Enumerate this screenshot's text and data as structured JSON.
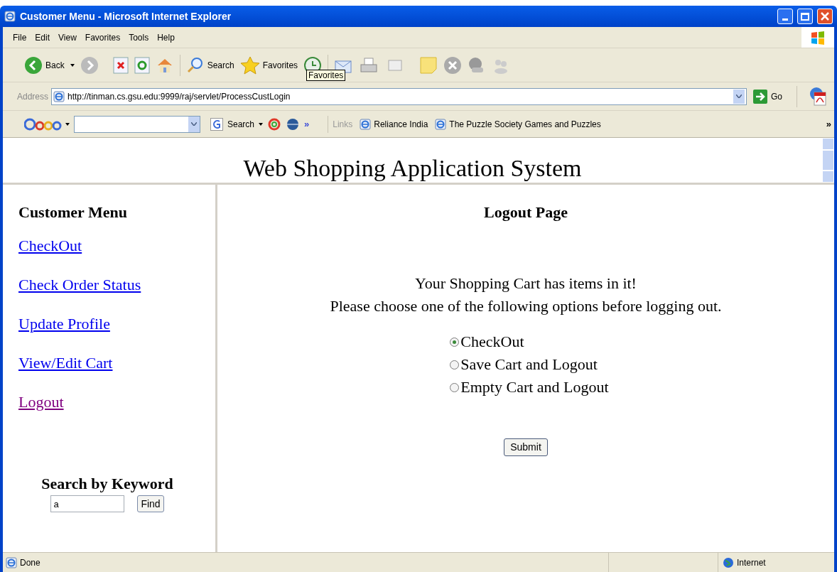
{
  "window": {
    "title": "Customer Menu - Microsoft Internet Explorer"
  },
  "menu": [
    "File",
    "Edit",
    "View",
    "Favorites",
    "Tools",
    "Help"
  ],
  "toolbar": {
    "back": "Back",
    "search": "Search",
    "favorites": "Favorites",
    "tooltip": "Favorites"
  },
  "address": {
    "label": "Address",
    "url": "http://tinman.cs.gsu.edu:9999/raj/servlet/ProcessCustLogin",
    "go": "Go"
  },
  "google_bar": {
    "search": "Search",
    "more": "»",
    "links_label": "Links",
    "links": [
      "Reliance India",
      "The Puzzle Society Games and Puzzles"
    ],
    "overflow": "»"
  },
  "header": {
    "title": "Web Shopping Application System"
  },
  "sidebar": {
    "title": "Customer Menu",
    "items": [
      {
        "label": "CheckOut",
        "visited": false
      },
      {
        "label": "Check Order Status",
        "visited": false
      },
      {
        "label": "Update Profile",
        "visited": false
      },
      {
        "label": "View/Edit Cart",
        "visited": false
      },
      {
        "label": "Logout",
        "visited": true
      }
    ],
    "search": {
      "title": "Search by Keyword",
      "value": "a",
      "button": "Find"
    }
  },
  "main": {
    "title": "Logout Page",
    "message": [
      "Your Shopping Cart has items in it!",
      "Please choose one of the following options before logging out."
    ],
    "options": [
      {
        "label": "CheckOut",
        "selected": true
      },
      {
        "label": "Save Cart and Logout",
        "selected": false
      },
      {
        "label": "Empty Cart and Logout",
        "selected": false
      }
    ],
    "submit": "Submit"
  },
  "status_bar": {
    "text": "Done",
    "zone": "Internet"
  }
}
